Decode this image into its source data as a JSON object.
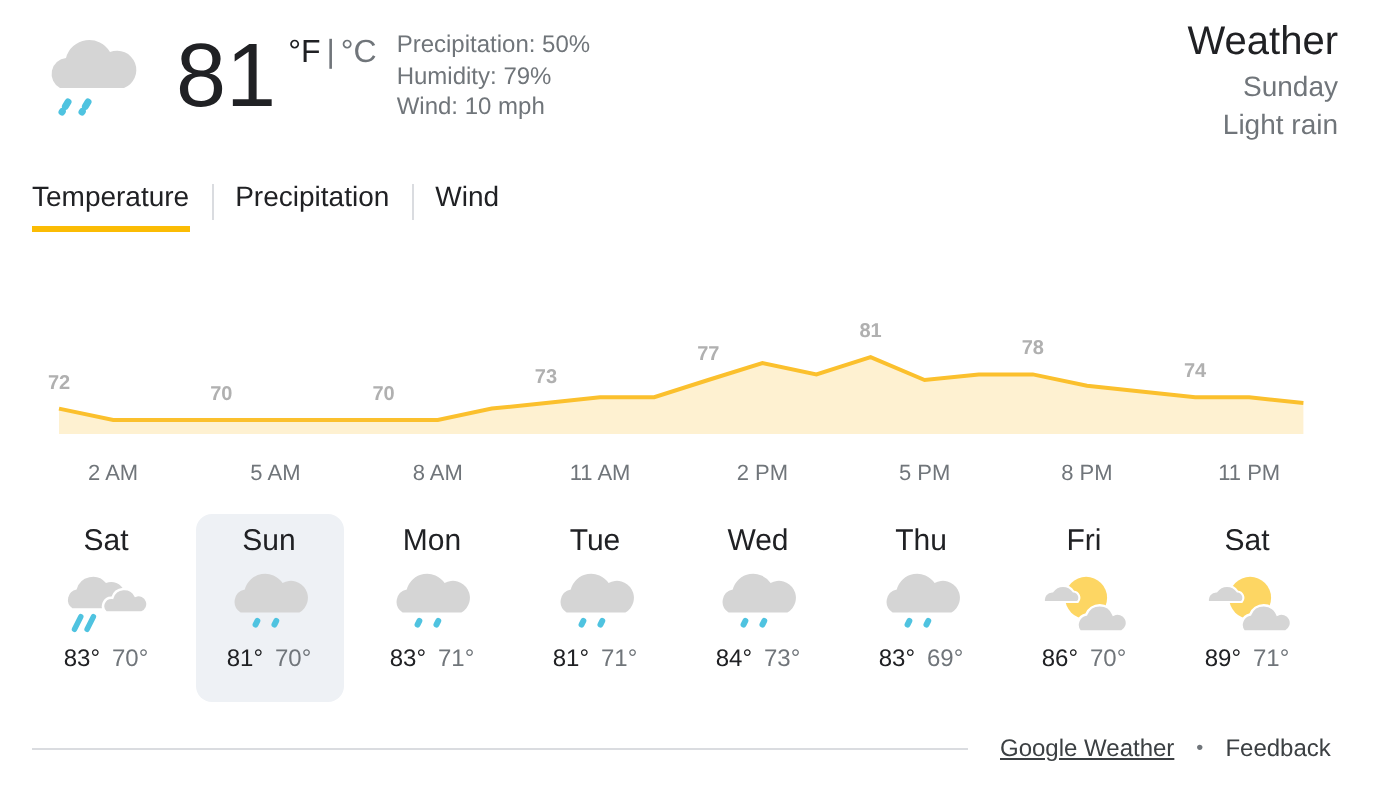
{
  "current": {
    "temperature": "81",
    "unit_f": "°F",
    "unit_sep": "|",
    "unit_c": "°C",
    "details": [
      "Precipitation: 50%",
      "Humidity: 79%",
      "Wind: 10 mph"
    ]
  },
  "heading": {
    "title": "Weather",
    "day": "Sunday",
    "condition": "Light rain"
  },
  "tabs": [
    {
      "label": "Temperature",
      "selected": true
    },
    {
      "label": "Precipitation",
      "selected": false
    },
    {
      "label": "Wind",
      "selected": false
    }
  ],
  "chart_data": {
    "type": "area",
    "categories": [
      null,
      "2 AM",
      null,
      null,
      "5 AM",
      null,
      null,
      "8 AM",
      null,
      null,
      "11 AM",
      null,
      null,
      "2 PM",
      null,
      null,
      "5 PM",
      null,
      null,
      "8 PM",
      null,
      null,
      "11 PM",
      null
    ],
    "series": [
      {
        "color": "#fbc02d",
        "values": [
          72,
          70,
          70,
          70,
          70,
          70,
          70,
          70,
          72,
          73,
          74,
          74,
          77,
          80,
          78,
          81,
          77,
          78,
          78,
          76,
          75,
          74,
          74,
          73
        ],
        "value_labels": [
          "72",
          null,
          null,
          "70",
          null,
          null,
          "70",
          null,
          null,
          "73",
          null,
          null,
          "77",
          null,
          null,
          "81",
          null,
          null,
          "78",
          null,
          null,
          "74",
          null,
          null
        ]
      }
    ]
  },
  "days": [
    {
      "day": "Sat",
      "kind": "rain_cloudy",
      "high": "83°",
      "low": "70°",
      "selected": false
    },
    {
      "day": "Sun",
      "kind": "rain",
      "high": "81°",
      "low": "70°",
      "selected": true
    },
    {
      "day": "Mon",
      "kind": "rain",
      "high": "83°",
      "low": "71°",
      "selected": false
    },
    {
      "day": "Tue",
      "kind": "rain",
      "high": "81°",
      "low": "71°",
      "selected": false
    },
    {
      "day": "Wed",
      "kind": "rain",
      "high": "84°",
      "low": "73°",
      "selected": false
    },
    {
      "day": "Thu",
      "kind": "rain",
      "high": "83°",
      "low": "69°",
      "selected": false
    },
    {
      "day": "Fri",
      "kind": "partly_sunny",
      "high": "86°",
      "low": "70°",
      "selected": false
    },
    {
      "day": "Sat",
      "kind": "partly_sunny",
      "high": "89°",
      "low": "71°",
      "selected": false
    }
  ],
  "footer": {
    "link": "Google Weather",
    "separator": "•",
    "feedback": "Feedback"
  }
}
